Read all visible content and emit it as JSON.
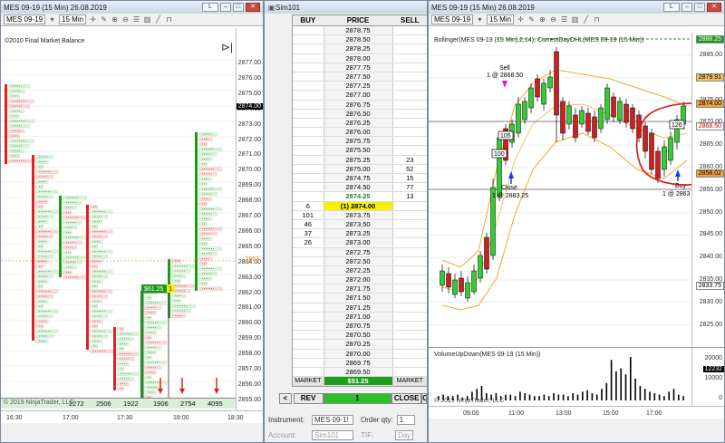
{
  "left_chart": {
    "title": "MES 09-19 (15 Min)  26.08.2019",
    "instrument": "MES 09-19",
    "timeframe": "15 Min",
    "indicator_label": "©2010 Final Market Balance",
    "price_ticks": [
      "2877.00",
      "2876.00",
      "2875.00",
      "2874.00",
      "2873.00",
      "2872.00",
      "2871.00",
      "2870.00",
      "2869.00",
      "2868.00",
      "2867.00",
      "2866.00",
      "2865.00",
      "2864.00",
      "2863.00",
      "2862.00",
      "2861.00",
      "2860.00",
      "2859.00",
      "2858.00",
      "2857.00",
      "2856.00",
      "2855.00"
    ],
    "current_price_label": "2874.00",
    "marker_price_label": "2863",
    "position_badge": "$61.25",
    "position_qty": "1",
    "volume_values": [
      "2272",
      "2506",
      "1922",
      "1906",
      "2754",
      "4095"
    ],
    "footer_copyright": "© 2019 NinjaTrader, LLC",
    "time_ticks": [
      "16:30",
      "17:00",
      "17:30",
      "18:00",
      "18:30"
    ],
    "l_button": "L"
  },
  "dom": {
    "title": "Sim101",
    "headers": {
      "buy": "BUY",
      "price": "PRICE",
      "sell": "SELL"
    },
    "rows": [
      {
        "buy": "",
        "price": "2878.75",
        "sell": ""
      },
      {
        "buy": "",
        "price": "2878.50",
        "sell": ""
      },
      {
        "buy": "",
        "price": "2878.25",
        "sell": ""
      },
      {
        "buy": "",
        "price": "2878.00",
        "sell": ""
      },
      {
        "buy": "",
        "price": "2877.75",
        "sell": ""
      },
      {
        "buy": "",
        "price": "2877.50",
        "sell": ""
      },
      {
        "buy": "",
        "price": "2877.25",
        "sell": ""
      },
      {
        "buy": "",
        "price": "2877.00",
        "sell": ""
      },
      {
        "buy": "",
        "price": "2876.75",
        "sell": ""
      },
      {
        "buy": "",
        "price": "2876.50",
        "sell": ""
      },
      {
        "buy": "",
        "price": "2876.25",
        "sell": ""
      },
      {
        "buy": "",
        "price": "2876.00",
        "sell": ""
      },
      {
        "buy": "",
        "price": "2875.75",
        "sell": ""
      },
      {
        "buy": "",
        "price": "2875.50",
        "sell": ""
      },
      {
        "buy": "",
        "price": "2875.25",
        "sell": "23"
      },
      {
        "buy": "",
        "price": "2875.00",
        "sell": "52"
      },
      {
        "buy": "",
        "price": "2874.75",
        "sell": "15"
      },
      {
        "buy": "",
        "price": "2874.50",
        "sell": "77"
      },
      {
        "buy": "",
        "price": "2874.25",
        "sell": "13",
        "state": "last"
      },
      {
        "buy": "6",
        "price": "(1) 2874.00",
        "sell": "",
        "state": "pos"
      },
      {
        "buy": "101",
        "price": "2873.75",
        "sell": ""
      },
      {
        "buy": "46",
        "price": "2873.50",
        "sell": ""
      },
      {
        "buy": "37",
        "price": "2873.25",
        "sell": ""
      },
      {
        "buy": "26",
        "price": "2873.00",
        "sell": ""
      },
      {
        "buy": "",
        "price": "2872.75",
        "sell": ""
      },
      {
        "buy": "",
        "price": "2872.50",
        "sell": ""
      },
      {
        "buy": "",
        "price": "2872.25",
        "sell": ""
      },
      {
        "buy": "",
        "price": "2872.00",
        "sell": ""
      },
      {
        "buy": "",
        "price": "2871.75",
        "sell": ""
      },
      {
        "buy": "",
        "price": "2871.50",
        "sell": ""
      },
      {
        "buy": "",
        "price": "2871.25",
        "sell": ""
      },
      {
        "buy": "",
        "price": "2871.00",
        "sell": ""
      },
      {
        "buy": "",
        "price": "2870.75",
        "sell": ""
      },
      {
        "buy": "",
        "price": "2870.50",
        "sell": ""
      },
      {
        "buy": "",
        "price": "2870.25",
        "sell": ""
      },
      {
        "buy": "",
        "price": "2870.00",
        "sell": ""
      },
      {
        "buy": "",
        "price": "2869.75",
        "sell": ""
      },
      {
        "buy": "",
        "price": "2869.50",
        "sell": ""
      }
    ],
    "market_left": "MARKET",
    "market_right": "MARKET",
    "pnl": "$51.25",
    "btn_prev": "<",
    "btn_rev": "REV",
    "qty": "1",
    "btn_close": "CLOSE",
    "btn_next": "C",
    "instrument_label": "Instrument:",
    "instrument_value": "MES 09-1!",
    "orderqty_label": "Order qty:",
    "orderqty_value": "1",
    "account_label": "Account:",
    "account_value": "Sim101",
    "tif_label": "TIF:",
    "tif_value": "Day"
  },
  "right_chart": {
    "title": "MES 09-19 (15 Min)  26.08.2019",
    "instrument": "MES 09-19",
    "timeframe": "15 Min",
    "indicator_label": "Bollinger(MES 09-19 (15 Min),2,14), CurrentDayOHL(MES 09-19 (15 Min))",
    "price_ticks": [
      "2885.00",
      "2880.00",
      "2875.00",
      "2870.00",
      "2865.00",
      "2860.00",
      "2855.00",
      "2850.00",
      "2845.00",
      "2840.00",
      "2835.00",
      "2830.00",
      "2825.00"
    ],
    "tag_high": "2888.25",
    "tag_mid": "2879.91",
    "tag_orange1": "2874.00",
    "tag_orange2": "2868.50",
    "tag_orange3": "2858.02",
    "tag_low": "2833.75",
    "sell_label": "Sell",
    "sell_price": "1 @ 2868.50",
    "close_label": "Close",
    "close_price": "1 @ 2883.25",
    "buy_label": "Buy",
    "buy_price": "1 @ 2863",
    "box_105": "105",
    "box_100": "100",
    "box_126": "126",
    "volume_label": "VolumeUpDown(MES 09-19 (15 Min))",
    "vol_ticks": [
      "20000",
      "10000",
      "0"
    ],
    "vol_tag": "12232",
    "footer_copyright": "© 2019 NinjaTrader, LLC",
    "time_ticks": [
      "09:00",
      "11:00",
      "13:00",
      "15:00",
      "17:00"
    ],
    "l_button": "L"
  }
}
